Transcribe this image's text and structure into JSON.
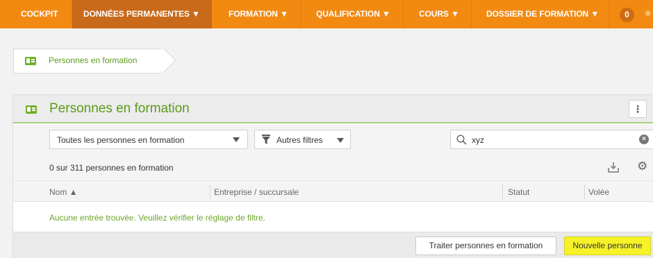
{
  "nav": {
    "items": [
      {
        "label": "COCKPIT"
      },
      {
        "label": "DONNÉES PERMANENTES ▼"
      },
      {
        "label": "FORMATION ▼"
      },
      {
        "label": "QUALIFICATION ▼"
      },
      {
        "label": "COURS ▼"
      },
      {
        "label": "DOSSIER DE FORMATION ▼"
      }
    ],
    "active_index": 1,
    "badge_count": "0",
    "colors": {
      "bar": "#f28a12",
      "active": "#c9691a"
    }
  },
  "breadcrumb": {
    "icon": "person-card-icon",
    "label": "Personnes en formation"
  },
  "panel": {
    "icon": "person-card-icon",
    "title": "Personnes en formation",
    "menu_icon": "kebab-menu-icon",
    "filter_select": {
      "value": "Toutes les personnes en formation"
    },
    "filter_button": {
      "label": "Autres filtres",
      "icon": "funnel-icon"
    },
    "search": {
      "value": "xyz",
      "icon": "search-icon",
      "clear_icon": "clear-circle-icon"
    },
    "count_text": "0 sur 311 personnes en formation",
    "toolbar_icons": [
      "export-icon",
      "gear-icon"
    ],
    "columns": [
      {
        "label": "Nom ▲",
        "sorted": "asc"
      },
      {
        "label": "Entreprise / succursale"
      },
      {
        "label": "Statut"
      },
      {
        "label": "Volée"
      }
    ],
    "empty_message": "Aucune entrée trouvée. Veuillez vérifier le réglage de filtre.",
    "footer": {
      "secondary_button": "Traiter personnes en formation",
      "primary_button": "Nouvelle personne"
    }
  },
  "colors": {
    "accent_green": "#5a9b1b",
    "highlight_yellow": "#f7f228"
  }
}
